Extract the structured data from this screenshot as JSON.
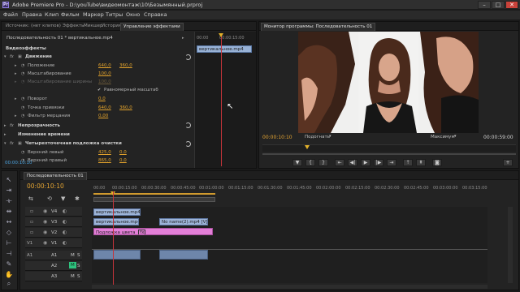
{
  "window": {
    "title": "Adobe Premiere Pro - D:\\youTube\\видеомонтаж\\10\\Безымянный.prproj",
    "logo": "Pr",
    "minimize": "–",
    "maximize": "□",
    "close": "✕"
  },
  "menu": [
    "Файл",
    "Правка",
    "Клип",
    "Фильм",
    "Маркер",
    "Титры",
    "Окно",
    "Справка"
  ],
  "effects_panel": {
    "tabs": [
      "Источник: (нет клипов)",
      "Эффекты",
      "Микшер",
      "История",
      "Управление эффектами"
    ],
    "sequence_label": "Последовательность 01 * вертикальное.mp4",
    "video_effects_header": "Видеоэффекты",
    "motion": {
      "name": "Движение",
      "fx": "fx",
      "rows": [
        {
          "label": "Положение",
          "v1": "640,0",
          "v2": "360,0"
        },
        {
          "label": "Масштабирование",
          "v1": "100,0",
          "v2": ""
        },
        {
          "label": "Масштабирование ширины",
          "v1": "100,0",
          "v2": ""
        },
        {
          "label": "Равномерный масштаб",
          "v1": "",
          "v2": ""
        },
        {
          "label": "Поворот",
          "v1": "0,0",
          "v2": ""
        },
        {
          "label": "Точка привязки",
          "v1": "640,0",
          "v2": "360,0"
        },
        {
          "label": "Фильтр мерцания",
          "v1": "0,00",
          "v2": ""
        }
      ]
    },
    "opacity": {
      "name": "Непрозрачность",
      "fx": "fx"
    },
    "time_remap": {
      "name": "Изменение времени"
    },
    "crop": {
      "name": "Четырехточечная подложка очистки",
      "fx": "fx",
      "rows": [
        {
          "label": "Верхний левый",
          "v1": "425,0",
          "v2": "0,0"
        },
        {
          "label": "Верхний правый",
          "v1": "865,0",
          "v2": "0,0"
        }
      ]
    },
    "mini_ruler_time": "00:00:15:00",
    "mini_ruler_start": "00:00",
    "clip_name": "вертикальное.mp4",
    "current_time": "00:00:10:10"
  },
  "program_monitor": {
    "tab": "Монитор программы: Последовательность 01",
    "timecode": "00:00:10:10",
    "fit": "Подогнать",
    "quality": "Максимум",
    "duration": "00:00:59:00"
  },
  "timeline": {
    "tab": "Последовательность 01",
    "timecode": "00:00:10:10",
    "ruler": [
      "00:00",
      "00:00:15:00",
      "00:00:30:00",
      "00:00:45:00",
      "00:01:00:00",
      "00:01:15:00",
      "00:01:30:00",
      "00:01:45:00",
      "00:02:00:00",
      "00:02:15:00",
      "00:02:30:00",
      "00:02:45:00",
      "00:03:00:00",
      "00:03:15:00"
    ],
    "tracks": {
      "v4": "V4",
      "v3": "V3",
      "v2": "V2",
      "v1": "V1",
      "v1_target": "V1",
      "a1": "A1",
      "a2": "A2",
      "a3": "A3",
      "a1_target": "A1",
      "mute": "M",
      "solo": "S"
    },
    "clips": {
      "v3": "вертикальное.mp4 [V]",
      "v2a": "вертикальное.mp4",
      "v2b": "No name(2).mp4 [V]",
      "v1": "Подложка цвета",
      "fx_badge": "fx"
    }
  }
}
